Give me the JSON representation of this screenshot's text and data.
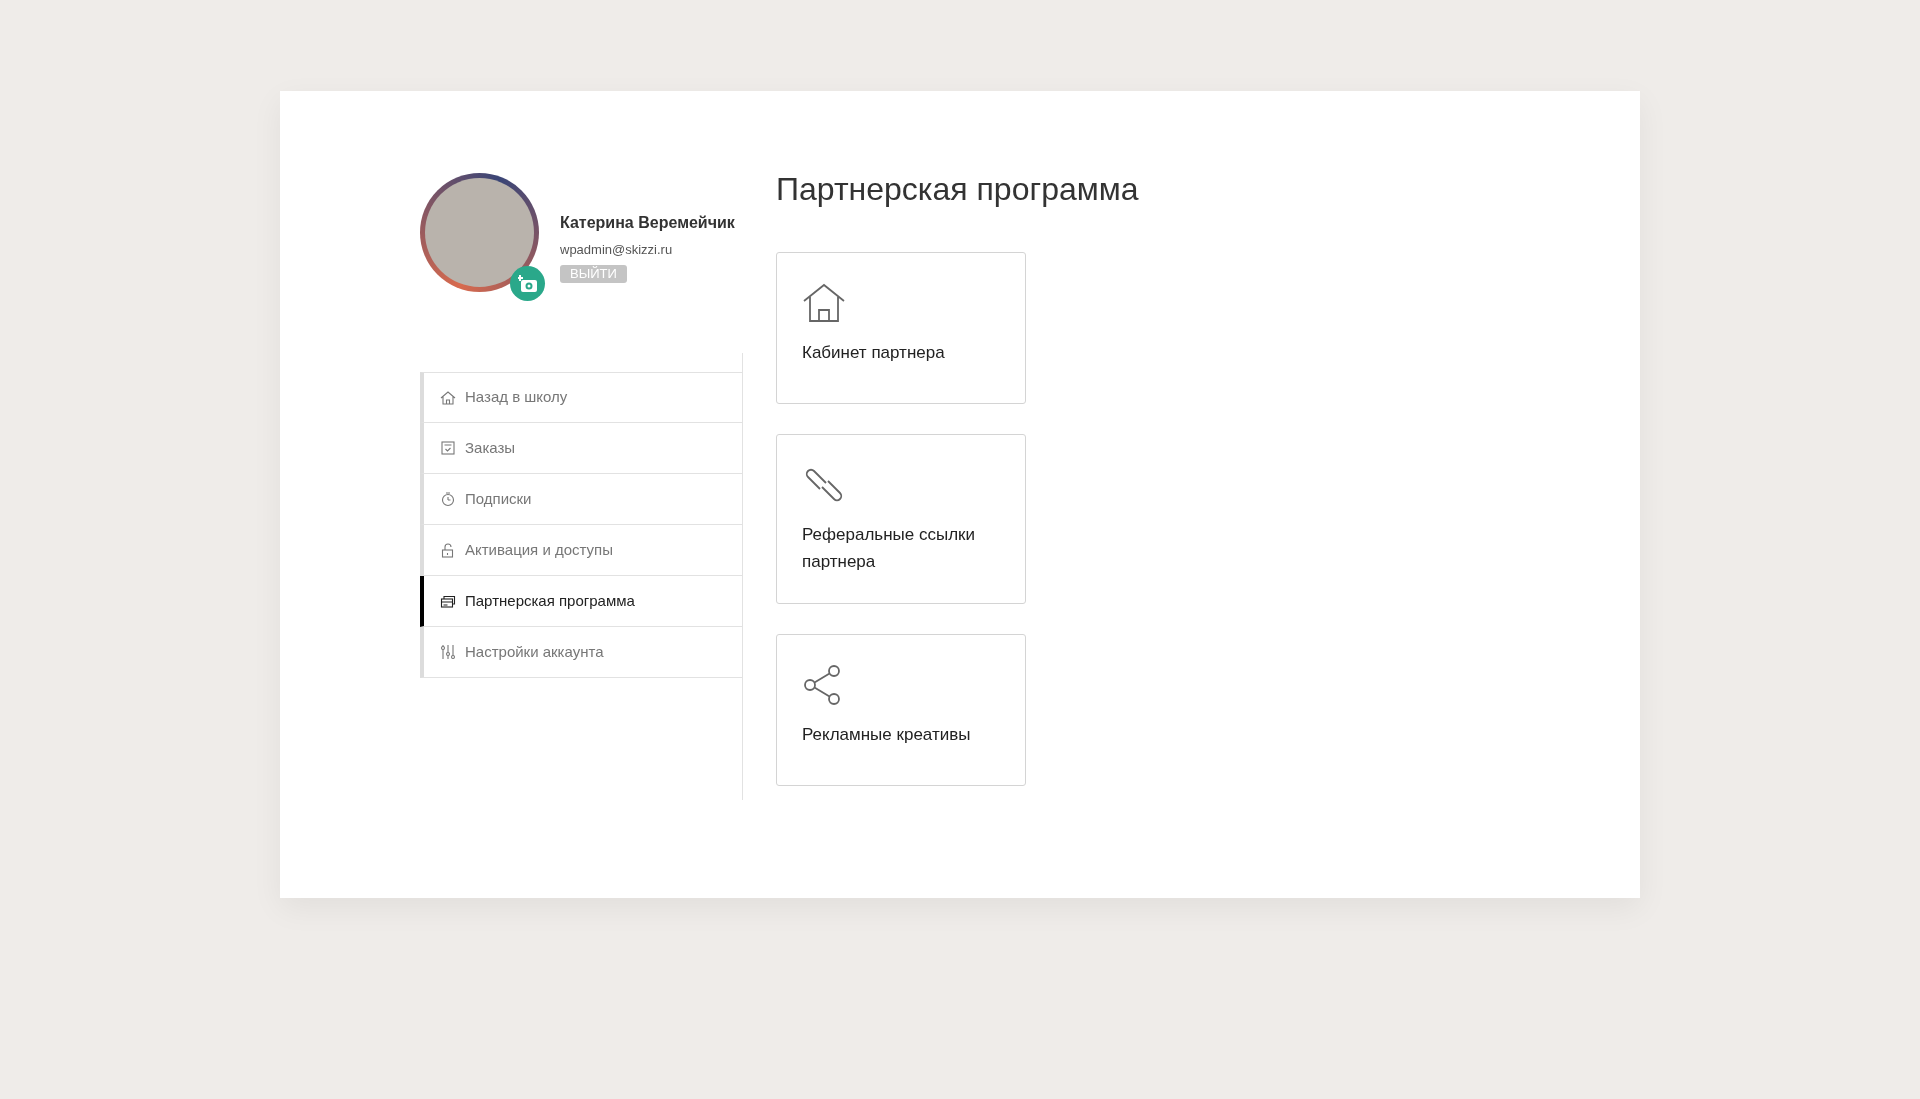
{
  "profile": {
    "name": "Катерина Веремейчик",
    "email": "wpadmin@skizzi.ru",
    "logout": "ВЫЙТИ"
  },
  "menu": [
    {
      "kind": "home",
      "label": "Назад в школу",
      "selected": false
    },
    {
      "kind": "orders",
      "label": "Заказы",
      "selected": false
    },
    {
      "kind": "timer",
      "label": "Подписки",
      "selected": false
    },
    {
      "kind": "lock",
      "label": "Активация и доступы",
      "selected": false
    },
    {
      "kind": "partner",
      "label": "Партнерская программа",
      "selected": true
    },
    {
      "kind": "settings",
      "label": "Настройки аккаунта",
      "selected": false
    }
  ],
  "page_title": "Партнерская программа",
  "tiles": [
    {
      "kind": "home",
      "label": "Кабинет партнера"
    },
    {
      "kind": "link",
      "label": "Реферальные ссылки партнера"
    },
    {
      "kind": "share",
      "label": "Рекламные креативы"
    }
  ]
}
